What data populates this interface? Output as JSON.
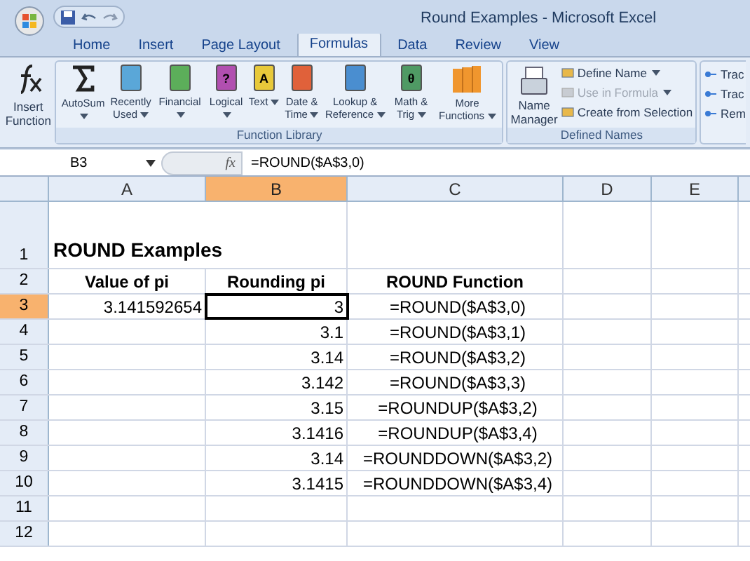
{
  "window": {
    "title": "Round Examples - Microsoft Excel"
  },
  "quick_access": [
    {
      "kind": "save"
    },
    {
      "kind": "undo"
    },
    {
      "kind": "redo"
    }
  ],
  "tabs": [
    {
      "label": "Home",
      "selected": false
    },
    {
      "label": "Insert",
      "selected": false
    },
    {
      "label": "Page Layout",
      "selected": false
    },
    {
      "label": "Formulas",
      "selected": true
    },
    {
      "label": "Data",
      "selected": false
    },
    {
      "label": "Review",
      "selected": false
    },
    {
      "label": "View",
      "selected": false
    }
  ],
  "ribbon": {
    "insert_function": {
      "label": "Insert Function"
    },
    "function_library": {
      "title": "Function Library",
      "buttons": [
        {
          "label": "AutoSum",
          "dropdown": true,
          "kind": "sigma"
        },
        {
          "label": "Recently Used",
          "dropdown": true,
          "kind": "book",
          "color": "#5aa7d8"
        },
        {
          "label": "Financial",
          "dropdown": true,
          "kind": "book",
          "color": "#5cae5a"
        },
        {
          "label": "Logical",
          "dropdown": true,
          "kind": "book",
          "color": "#b14fb0",
          "glyph": "?"
        },
        {
          "label": "Text",
          "dropdown": true,
          "kind": "book",
          "color": "#e8c93a",
          "glyph": "A"
        },
        {
          "label": "Date & Time",
          "dropdown": true,
          "kind": "book",
          "color": "#e0613a"
        },
        {
          "label": "Lookup & Reference",
          "dropdown": true,
          "kind": "book",
          "color": "#4a8ed0"
        },
        {
          "label": "Math & Trig",
          "dropdown": true,
          "kind": "book",
          "color": "#4f9a64",
          "glyph": "θ"
        },
        {
          "label": "More Functions",
          "dropdown": true,
          "kind": "books",
          "color": "#f0962e"
        }
      ]
    },
    "defined_names": {
      "title": "Defined Names",
      "manager": "Name Manager",
      "items": [
        {
          "label": "Define Name",
          "dropdown": true,
          "disabled": false
        },
        {
          "label": "Use in Formula",
          "dropdown": true,
          "disabled": true
        },
        {
          "label": "Create from Selection",
          "dropdown": false,
          "disabled": false
        }
      ]
    },
    "formula_auditing": {
      "items": [
        "Trac",
        "Trac",
        "Rem"
      ]
    }
  },
  "formula_bar": {
    "name_box": "B3",
    "fx": "fx",
    "formula": "=ROUND($A$3,0)"
  },
  "sheet": {
    "columns": [
      {
        "label": "A",
        "selected": false
      },
      {
        "label": "B",
        "selected": true
      },
      {
        "label": "C",
        "selected": false
      },
      {
        "label": "D",
        "selected": false
      },
      {
        "label": "E",
        "selected": false
      }
    ],
    "rows": [
      {
        "label": "1",
        "selected": false,
        "cells": [
          "ROUND Examples",
          "",
          ""
        ]
      },
      {
        "label": "2",
        "selected": false,
        "cells": [
          "Value of pi",
          "Rounding pi",
          "ROUND Function"
        ]
      },
      {
        "label": "3",
        "selected": true,
        "cells": [
          "3.141592654",
          "3",
          "=ROUND($A$3,0)"
        ]
      },
      {
        "label": "4",
        "selected": false,
        "cells": [
          "",
          "3.1",
          "=ROUND($A$3,1)"
        ]
      },
      {
        "label": "5",
        "selected": false,
        "cells": [
          "",
          "3.14",
          "=ROUND($A$3,2)"
        ]
      },
      {
        "label": "6",
        "selected": false,
        "cells": [
          "",
          "3.142",
          "=ROUND($A$3,3)"
        ]
      },
      {
        "label": "7",
        "selected": false,
        "cells": [
          "",
          "3.15",
          "=ROUNDUP($A$3,2)"
        ]
      },
      {
        "label": "8",
        "selected": false,
        "cells": [
          "",
          "3.1416",
          "=ROUNDUP($A$3,4)"
        ]
      },
      {
        "label": "9",
        "selected": false,
        "cells": [
          "",
          "3.14",
          "=ROUNDDOWN($A$3,2)"
        ]
      },
      {
        "label": "10",
        "selected": false,
        "cells": [
          "",
          "3.1415",
          "=ROUNDDOWN($A$3,4)"
        ]
      },
      {
        "label": "11",
        "selected": false,
        "cells": [
          "",
          "",
          ""
        ]
      },
      {
        "label": "12",
        "selected": false,
        "cells": [
          "",
          "",
          ""
        ]
      }
    ]
  }
}
